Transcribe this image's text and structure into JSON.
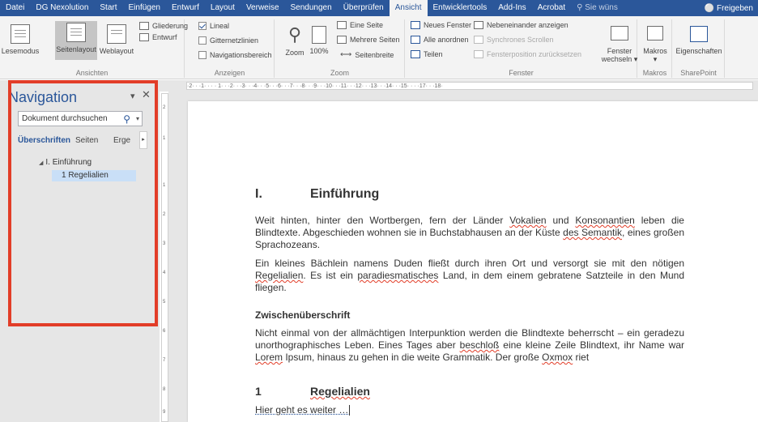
{
  "menu": {
    "items": [
      "Datei",
      "DG Nexolution",
      "Start",
      "Einfügen",
      "Entwurf",
      "Layout",
      "Verweise",
      "Sendungen",
      "Überprüfen",
      "Ansicht",
      "Entwicklertools",
      "Add-Ins",
      "Acrobat"
    ],
    "active": "Ansicht",
    "tell_me": "Sie wüns",
    "share": "Freigeben"
  },
  "ribbon": {
    "ansichten": {
      "label": "Ansichten",
      "lesemodus": "Lesemodus",
      "seitenlayout": "Seitenlayout",
      "weblayout": "Weblayout",
      "gliederung": "Gliederung",
      "entwurf": "Entwurf"
    },
    "anzeigen": {
      "label": "Anzeigen",
      "lineal": "Lineal",
      "gitternetzlinien": "Gitternetzlinien",
      "navigationsbereich": "Navigationsbereich",
      "lineal_checked": true
    },
    "zoom": {
      "label": "Zoom",
      "zoom": "Zoom",
      "percent": "100%",
      "eine_seite": "Eine Seite",
      "mehrere_seiten": "Mehrere Seiten",
      "seitenbreite": "Seitenbreite"
    },
    "fenster": {
      "label": "Fenster",
      "neues_fenster": "Neues Fenster",
      "alle_anordnen": "Alle anordnen",
      "teilen": "Teilen",
      "nebeneinander": "Nebeneinander anzeigen",
      "synchrones": "Synchrones Scrollen",
      "fensterposition": "Fensterposition zurücksetzen",
      "fenster_wechseln_1": "Fenster",
      "fenster_wechseln_2": "wechseln"
    },
    "makros": {
      "label": "Makros",
      "button": "Makros"
    },
    "sharepoint": {
      "label": "SharePoint",
      "button": "Eigenschaften"
    }
  },
  "ruler": {
    "horizontal": "·2·  ·  ·1·  ·  ·  ·  1·  ·  ·2·  ·  ·3·  ·  ·4·  ·  ·5·  ·  ·6·  ·  ·7·  ·  ·8·  ·  ·9·  ·  ·10·  ·  ·11·  ·  ·12·  ·  ·13·  ·  ·14·  ·  ·15·  ·  ·  ·17·  ·  ·18·",
    "vertical_numbers": [
      "2",
      "1",
      "1",
      "2",
      "3",
      "4",
      "5",
      "6",
      "7",
      "8",
      "9"
    ]
  },
  "navigation": {
    "title": "Navigation",
    "search_placeholder": "Dokument durchsuchen",
    "tabs": [
      "Überschriften",
      "Seiten",
      "Erge"
    ],
    "active_tab": "Überschriften",
    "tree": [
      {
        "label": "I. Einführung",
        "level": 1,
        "selected": false
      },
      {
        "label": "1 Regelialien",
        "level": 2,
        "selected": true
      }
    ]
  },
  "document": {
    "heading1": {
      "number": "I.",
      "text": "Einführung"
    },
    "para1": {
      "t1": "Weit hinten, hinter den Wortbergen, fern der Länder ",
      "w1": "Vokalien",
      "t2": " und ",
      "w2": "Konsonantien",
      "t3": " leben die Blindtexte. Abgeschieden wohnen sie in Buchstabhausen an der Küste ",
      "w3": "des Semantik",
      "t4": ", eines großen Sprachozeans."
    },
    "para2": {
      "t1": "Ein kleines Bächlein namens Duden fließt durch ihren Ort und versorgt sie mit den nötigen ",
      "w1": "Regelialien",
      "t2": ". Es ist ein ",
      "w2": "paradiesmatisches",
      "t3": " Land, in dem einem gebratene Satzteile in den Mund fliegen."
    },
    "subheading": "Zwischenüberschrift",
    "para3": {
      "t1": "Nicht einmal von der allmächtigen Interpunktion werden die Blindtexte beherrscht – ein geradezu unorthographisches Leben. Eines Tages aber ",
      "w1": "beschloß",
      "t2": " eine kleine Zeile Blindtext, ihr Name war ",
      "w2": "Lorem",
      "t3": " Ipsum, hinaus zu gehen in die weite Grammatik. Der große ",
      "w3": "Oxmox",
      "t4": " riet"
    },
    "heading2": {
      "number": "1",
      "text": "Regelialien"
    },
    "para4": "Hier geht es weiter …"
  },
  "colors": {
    "accent": "#2b579a",
    "highlight": "#e23d28",
    "ribbon_bg": "#f3f3f3",
    "nav_bg": "#e6e6e6",
    "tree_selected": "#c9dff7"
  }
}
